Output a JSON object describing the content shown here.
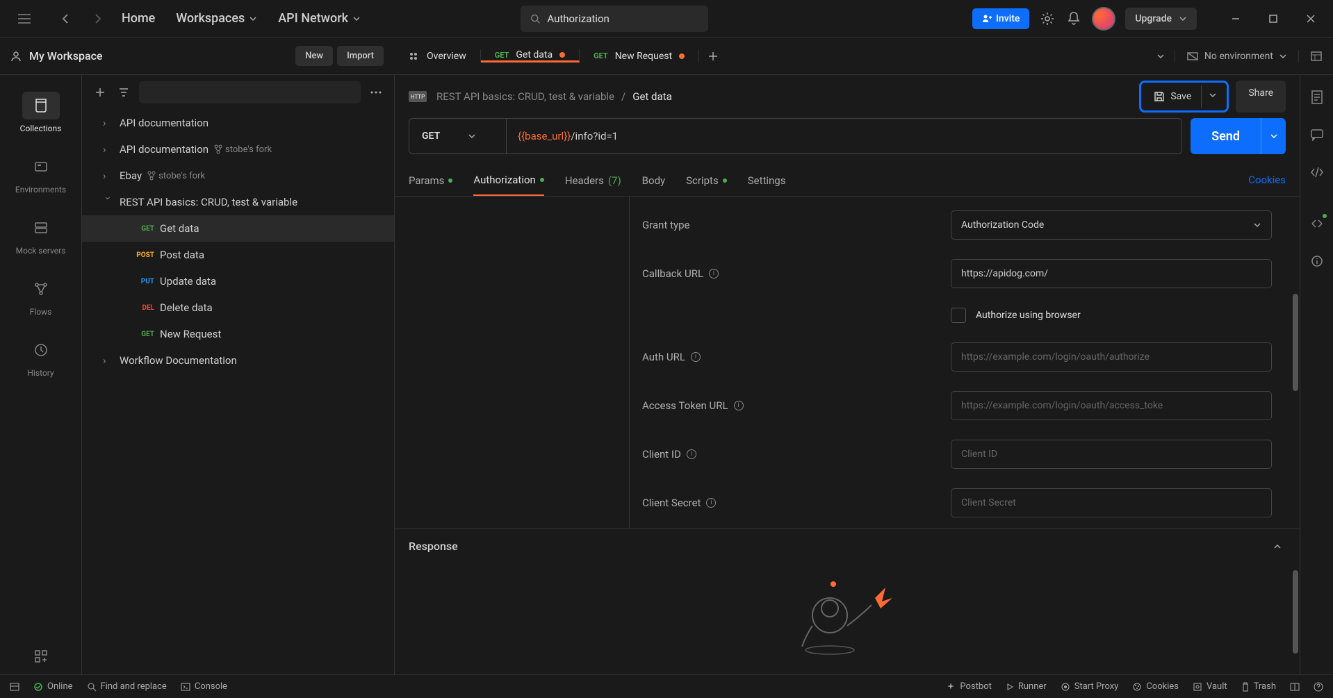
{
  "topbar": {
    "home": "Home",
    "workspaces": "Workspaces",
    "apiNetwork": "API Network",
    "searchValue": "Authorization",
    "invite": "Invite",
    "upgrade": "Upgrade"
  },
  "workspace": {
    "name": "My Workspace",
    "newBtn": "New",
    "importBtn": "Import"
  },
  "tabs": [
    {
      "icon": "overview",
      "label": "Overview",
      "method": "",
      "unsaved": false,
      "active": false
    },
    {
      "method": "GET",
      "label": "Get data",
      "unsaved": true,
      "active": true
    },
    {
      "method": "GET",
      "label": "New Request",
      "unsaved": true,
      "active": false
    }
  ],
  "environment": {
    "label": "No environment"
  },
  "rail": [
    {
      "icon": "collections",
      "label": "Collections",
      "active": true
    },
    {
      "icon": "environments",
      "label": "Environments"
    },
    {
      "icon": "mock",
      "label": "Mock servers"
    },
    {
      "icon": "flows",
      "label": "Flows"
    },
    {
      "icon": "history",
      "label": "History"
    }
  ],
  "tree": {
    "items": [
      {
        "type": "folder",
        "label": "API documentation",
        "expanded": false
      },
      {
        "type": "folder",
        "label": "API documentation",
        "expanded": false,
        "fork": "stobe's fork"
      },
      {
        "type": "folder",
        "label": "Ebay",
        "expanded": false,
        "fork": "stobe's fork"
      },
      {
        "type": "folder",
        "label": "REST API basics: CRUD, test & variable",
        "expanded": true,
        "children": [
          {
            "method": "GET",
            "label": "Get data",
            "active": true
          },
          {
            "method": "POST",
            "label": "Post data"
          },
          {
            "method": "PUT",
            "label": "Update data"
          },
          {
            "method": "DEL",
            "label": "Delete data"
          },
          {
            "method": "GET",
            "label": "New Request"
          }
        ]
      },
      {
        "type": "folder",
        "label": "Workflow Documentation",
        "expanded": false
      }
    ]
  },
  "breadcrumb": {
    "parent": "REST API basics: CRUD, test & variable",
    "current": "Get data",
    "save": "Save",
    "share": "Share"
  },
  "request": {
    "method": "GET",
    "urlVar": "{{base_url}}",
    "urlPath": "/info?id=1",
    "send": "Send"
  },
  "subtabs": {
    "params": "Params",
    "authorization": "Authorization",
    "headers": "Headers",
    "headerCount": "(7)",
    "body": "Body",
    "scripts": "Scripts",
    "settings": "Settings",
    "cookies": "Cookies"
  },
  "authForm": {
    "grantType": {
      "label": "Grant type",
      "value": "Authorization Code"
    },
    "callbackUrl": {
      "label": "Callback URL",
      "value": "https://apidog.com/"
    },
    "authorizeBrowser": "Authorize using browser",
    "authUrl": {
      "label": "Auth URL",
      "placeholder": "https://example.com/login/oauth/authorize"
    },
    "accessTokenUrl": {
      "label": "Access Token URL",
      "placeholder": "https://example.com/login/oauth/access_toke"
    },
    "clientId": {
      "label": "Client ID",
      "placeholder": "Client ID"
    },
    "clientSecret": {
      "label": "Client Secret",
      "placeholder": "Client Secret"
    }
  },
  "response": {
    "title": "Response"
  },
  "statusbar": {
    "online": "Online",
    "findReplace": "Find and replace",
    "console": "Console",
    "postbot": "Postbot",
    "runner": "Runner",
    "startProxy": "Start Proxy",
    "cookies": "Cookies",
    "vault": "Vault",
    "trash": "Trash"
  },
  "methodColors": {
    "GET": "#4caf50",
    "POST": "#ffb020",
    "PUT": "#2196f3",
    "DEL": "#f44336"
  }
}
